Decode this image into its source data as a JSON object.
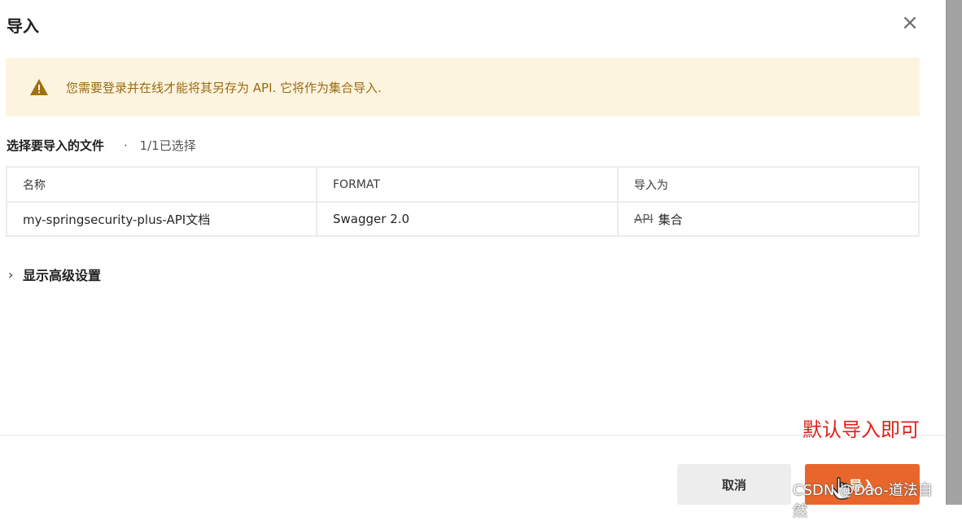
{
  "dialog": {
    "title": "导入",
    "close_icon": "×"
  },
  "warning": {
    "icon": "warning-icon",
    "text": "您需要登录并在线才能将其另存为 API. 它将作为集合导入."
  },
  "files": {
    "label": "选择要导入的文件",
    "separator": "·",
    "count": "1/1已选择",
    "columns": [
      "名称",
      "FORMAT",
      "导入为"
    ],
    "rows": [
      {
        "name": "my-springsecurity-plus-API文档",
        "format": "Swagger 2.0",
        "import_as_struck": "API",
        "import_as": "集合"
      }
    ]
  },
  "advanced": {
    "chevron": "›",
    "label": "显示高级设置"
  },
  "annotation": "默认导入即可",
  "footer": {
    "cancel_label": "取消",
    "import_label": "导入"
  },
  "watermark": "CSDN @Dao-道法自然",
  "colors": {
    "warning_bg": "#fdf4e0",
    "warning_text": "#9a6a12",
    "primary_button": "#e8662c",
    "annotation": "#e0201c"
  }
}
